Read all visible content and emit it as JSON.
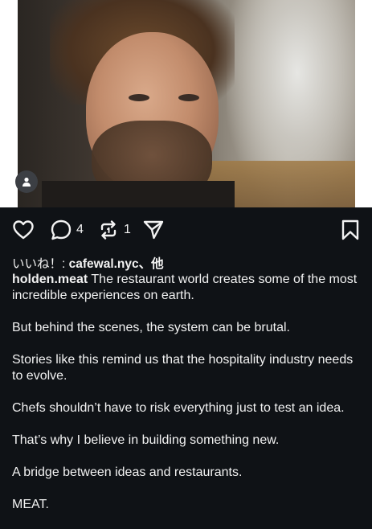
{
  "post": {
    "image_alt": "portrait photo",
    "actions": {
      "comments_count": "4",
      "reposts_count": "1"
    },
    "likes_prefix": "いいね！: ",
    "likes_user": "cafewal.nyc",
    "likes_suffix": "、他",
    "caption": {
      "username": "holden.meat",
      "first": " The restaurant world creates some of the most incredible experiences on earth.",
      "paragraphs": [
        "But behind the scenes, the system can be brutal.",
        "Stories like this remind us that the hospitality industry needs to evolve.",
        "Chefs shouldn’t have to risk everything just to test an idea.",
        "That’s why I believe in building something new.",
        "A bridge between ideas and restaurants.",
        "MEAT."
      ]
    }
  },
  "icons": [
    "heart-icon",
    "comment-icon",
    "repost-icon",
    "send-icon",
    "bookmark-icon",
    "person-icon"
  ],
  "colors": {
    "background": "#0f1216",
    "text": "#f2f2f2"
  }
}
